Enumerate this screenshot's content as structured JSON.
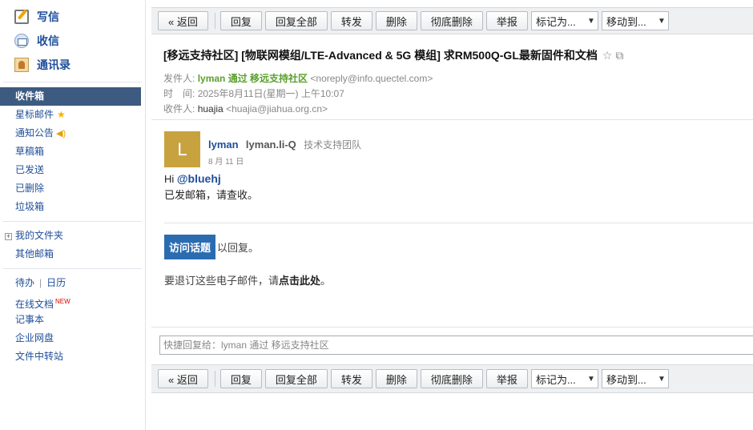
{
  "sidebar": {
    "top_actions": [
      {
        "label": "写信",
        "icon": "compose-icon"
      },
      {
        "label": "收信",
        "icon": "inbox-icon"
      },
      {
        "label": "通讯录",
        "icon": "contacts-icon"
      }
    ],
    "folders": [
      {
        "label": "收件箱",
        "active": true
      },
      {
        "label": "星标邮件",
        "badge_icon": "star-icon"
      },
      {
        "label": "通知公告",
        "badge_icon": "speaker-icon"
      },
      {
        "label": "草稿箱"
      },
      {
        "label": "已发送"
      },
      {
        "label": "已删除"
      },
      {
        "label": "垃圾箱"
      }
    ],
    "my_folders_label": "我的文件夹",
    "my_folders_expander": "+",
    "other_mailboxes_label": "其他邮箱",
    "tools": {
      "todo": "待办",
      "sep": "|",
      "calendar": "日历",
      "online_docs": "在线文档",
      "new_badge": "NEW",
      "notes": "记事本",
      "disk": "企业网盘",
      "transfer": "文件中转站"
    }
  },
  "toolbar": {
    "back": "« 返回",
    "reply": "回复",
    "reply_all": "回复全部",
    "forward": "转发",
    "delete": "删除",
    "delete_perm": "彻底删除",
    "report": "举报",
    "mark_as": "标记为...",
    "move_to": "移动到..."
  },
  "email": {
    "subject": "[移远支持社区] [物联网模组/LTE-Advanced & 5G 模组] 求RM500Q-GL最新固件和文档",
    "subject_icons": "☆ ⧉",
    "from_label": "发件人:",
    "from_name": "lyman 通过 移远支持社区",
    "from_addr": "<noreply@info.quectel.com>",
    "time_label": "时　间:",
    "time_value": "2025年8月11日(星期一) 上午10:07",
    "to_label": "收件人:",
    "to_name": "huajia",
    "to_addr": "<huajia@jiahua.org.cn>"
  },
  "post": {
    "avatar_letter": "L",
    "username": "lyman",
    "user_full": "lyman.li-Q",
    "team": "技术支持团队",
    "date": "8 月 11 日",
    "greeting": "Hi",
    "mention": "@bluehj",
    "message": "已发邮箱，请查收。",
    "visit_button": "访问话题",
    "visit_suffix": "以回复。",
    "unsub_prefix": "要退订这些电子邮件，请",
    "unsub_link": "点击此处",
    "unsub_suffix": "。"
  },
  "quick_reply": {
    "placeholder": "快捷回复给：lyman 通过 移远支持社区"
  },
  "colors": {
    "active_folder": "#3d5a80",
    "link_blue": "#1f4e99",
    "sender_green": "#5aa02c",
    "avatar": "#c8a23e",
    "visit_button": "#2b6cb0"
  }
}
